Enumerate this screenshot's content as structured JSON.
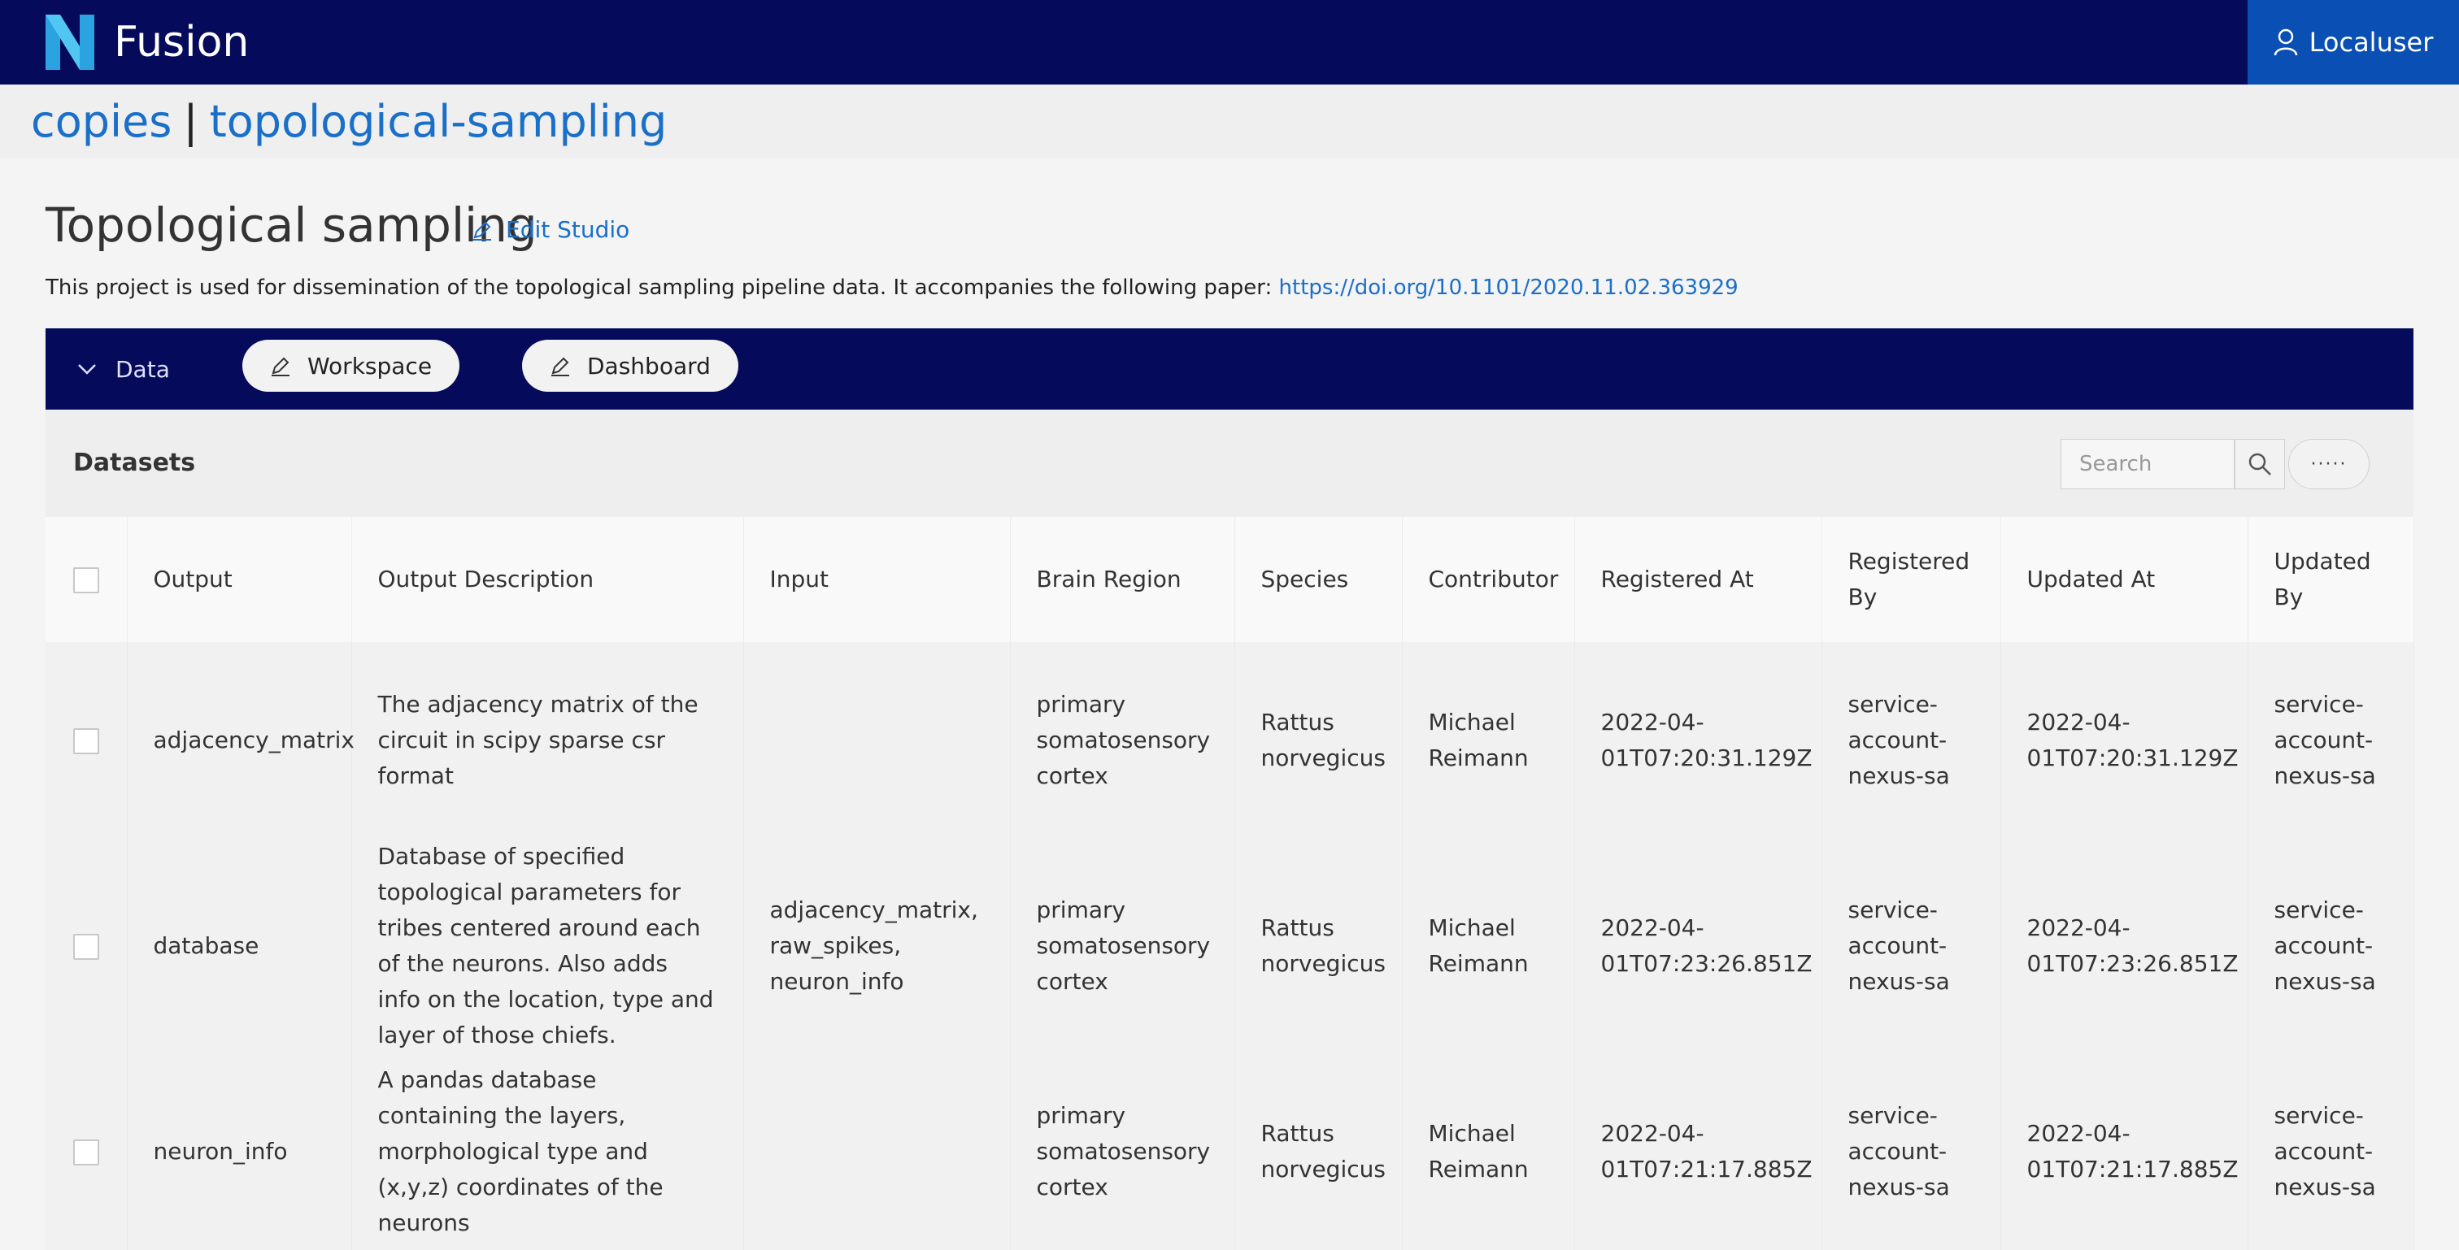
{
  "header": {
    "app_name": "Fusion",
    "user_label": "Localuser",
    "logo_color": "#2aa3e0",
    "bar_color": "#050a5a",
    "user_bg_color": "#0a4fb4"
  },
  "breadcrumb": {
    "project_org": "copies",
    "separator": "|",
    "project_name": "topological-sampling"
  },
  "studio": {
    "title": "Topological sampling",
    "edit_label": "Edit Studio",
    "description": "This project is used for dissemination of the topological sampling pipeline data. It accompanies the following paper: ",
    "link_text": "https://doi.org/10.1101/2020.11.02.363929"
  },
  "tabs": {
    "data_label": "Data",
    "workspace_label": "Workspace",
    "dashboard_label": "Dashboard"
  },
  "datasets": {
    "title": "Datasets",
    "search_placeholder": "Search",
    "more_label": "·····",
    "columns": [
      "Output",
      "Output Description",
      "Input",
      "Brain Region",
      "Species",
      "Contributor",
      "Registered At",
      "Registered By",
      "Updated At",
      "Updated By"
    ],
    "rows": [
      {
        "output": "adjacency_matrix",
        "description": "The adjacency matrix of the circuit in scipy sparse csr format",
        "input": "",
        "brain_region": "primary somatosensory cortex",
        "species": "Rattus norvegicus",
        "contributor": "Michael Reimann",
        "registered_at": "2022-04-01T07:20:31.129Z",
        "registered_by": "service-account-nexus-sa",
        "updated_at": "2022-04-01T07:20:31.129Z",
        "updated_by": "service-account-nexus-sa"
      },
      {
        "output": "database",
        "description": "Database of specified topological parameters for tribes centered around each of the neurons. Also adds info on the location, type and layer of those chiefs.",
        "input": "adjacency_matrix, raw_spikes, neuron_info",
        "brain_region": "primary somatosensory cortex",
        "species": "Rattus norvegicus",
        "contributor": "Michael Reimann",
        "registered_at": "2022-04-01T07:23:26.851Z",
        "registered_by": "service-account-nexus-sa",
        "updated_at": "2022-04-01T07:23:26.851Z",
        "updated_by": "service-account-nexus-sa"
      },
      {
        "output": "neuron_info",
        "description": "A pandas database containing the layers, morphological type and (x,y,z) coordinates of the neurons",
        "input": "",
        "brain_region": "primary somatosensory cortex",
        "species": "Rattus norvegicus",
        "contributor": "Michael Reimann",
        "registered_at": "2022-04-01T07:21:17.885Z",
        "registered_by": "service-account-nexus-sa",
        "updated_at": "2022-04-01T07:21:17.885Z",
        "updated_by": "service-account-nexus-sa"
      }
    ]
  }
}
